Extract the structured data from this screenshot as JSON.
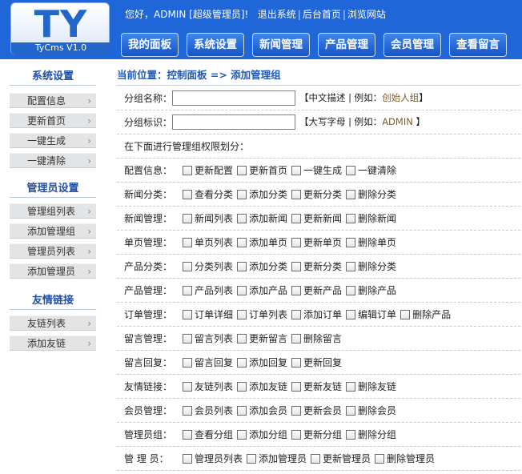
{
  "header": {
    "logo_main": "TY",
    "logo_sub": "TyCms V1.0",
    "greeting": "您好，ADMIN [超级管理员]!",
    "links": [
      "退出系统",
      "后台首页",
      "浏览网站"
    ],
    "link_sep": "|",
    "tabs": [
      "我的面板",
      "系统设置",
      "新闻管理",
      "产品管理",
      "会员管理",
      "查看留言"
    ]
  },
  "sidebar": {
    "sections": [
      {
        "title": "系统设置",
        "items": [
          "配置信息",
          "更新首页",
          "一键生成",
          "一键清除"
        ]
      },
      {
        "title": "管理员设置",
        "items": [
          "管理组列表",
          "添加管理组",
          "管理员列表",
          "添加管理员"
        ]
      },
      {
        "title": "友情链接",
        "items": [
          "友链列表",
          "添加友链"
        ]
      }
    ],
    "chevron": "›"
  },
  "breadcrumb": "当前位置：控制面板 => 添加管理组",
  "form": {
    "name_label": "分组名称：",
    "name_value": "",
    "name_hint_pre": "【中文描述 | 例如：",
    "name_hint_eg": "创始人组",
    "name_hint_post": "】",
    "id_label": "分组标识：",
    "id_value": "",
    "id_hint_pre": "【大写字母 | 例如：",
    "id_hint_eg": "ADMIN",
    "id_hint_post": " 】",
    "perm_note": "在下面进行管理组权限划分："
  },
  "permissions": [
    {
      "label": "配置信息：",
      "options": [
        "更新配置",
        "更新首页",
        "一键生成",
        "一键清除"
      ]
    },
    {
      "label": "新闻分类：",
      "options": [
        "查看分类",
        "添加分类",
        "更新分类",
        "删除分类"
      ]
    },
    {
      "label": "新闻管理：",
      "options": [
        "新闻列表",
        "添加新闻",
        "更新新闻",
        "删除新闻"
      ]
    },
    {
      "label": "单页管理：",
      "options": [
        "单页列表",
        "添加单页",
        "更新单页",
        "删除单页"
      ]
    },
    {
      "label": "产品分类：",
      "options": [
        "分类列表",
        "添加分类",
        "更新分类",
        "删除分类"
      ]
    },
    {
      "label": "产品管理：",
      "options": [
        "产品列表",
        "添加产品",
        "更新产品",
        "删除产品"
      ]
    },
    {
      "label": "订单管理：",
      "options": [
        "订单详细",
        "订单列表",
        "添加订单",
        "编辑订单",
        "删除产品"
      ]
    },
    {
      "label": "留言管理：",
      "options": [
        "留言列表",
        "更新留言",
        "删除留言"
      ]
    },
    {
      "label": "留言回复：",
      "options": [
        "留言回复",
        "添加回复",
        "更新回复"
      ]
    },
    {
      "label": "友情链接：",
      "options": [
        "友链列表",
        "添加友链",
        "更新友链",
        "删除友链"
      ]
    },
    {
      "label": "会员管理：",
      "options": [
        "会员列表",
        "添加会员",
        "更新会员",
        "删除会员"
      ]
    },
    {
      "label": "管理员组：",
      "options": [
        "查看分组",
        "添加分组",
        "更新分组",
        "删除分组"
      ]
    },
    {
      "label": "管 理 员：",
      "options": [
        "管理员列表",
        "添加管理员",
        "更新管理员",
        "删除管理员"
      ]
    }
  ]
}
